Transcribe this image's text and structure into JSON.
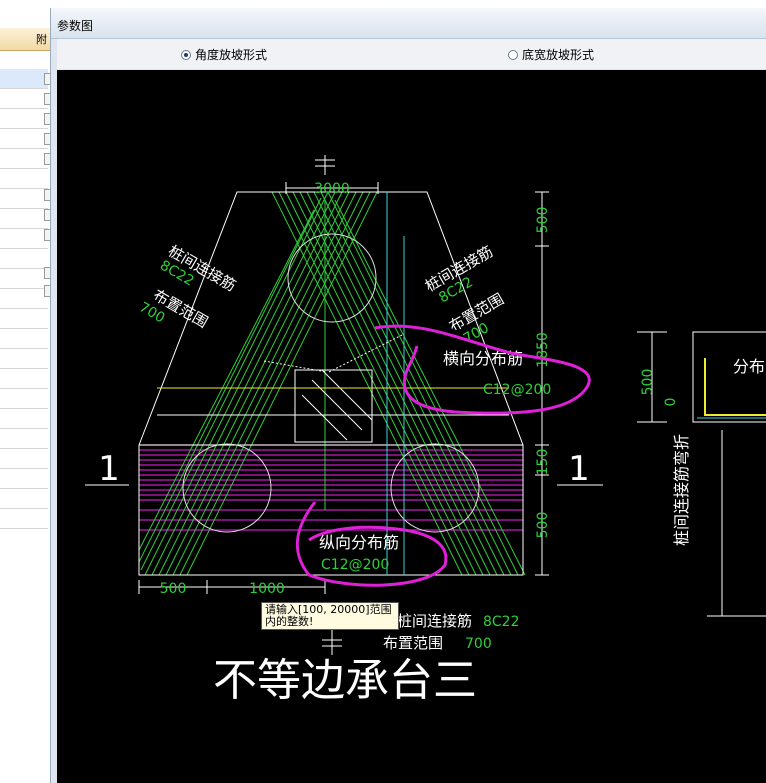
{
  "background_panel": {
    "column_header": "附"
  },
  "dialog": {
    "title": "参数图",
    "options": [
      {
        "label": "角度放坡形式",
        "selected": true
      },
      {
        "label": "底宽放坡形式",
        "selected": false
      }
    ]
  },
  "drawing": {
    "title": "不等边承台三",
    "dims": {
      "top_width": "3000",
      "right_top": "500",
      "right_mid": "1850",
      "right_low": "150",
      "right_bottom": "500",
      "bottom_left": "500",
      "bottom_mid": "1000",
      "side_500": "500",
      "side_0": "0"
    },
    "section_mark": "1",
    "labels": {
      "left_pile_link": "桩间连接筋",
      "left_pile_link_val": "8C22",
      "left_layout": "布置范围",
      "left_layout_val": "700",
      "right_pile_link": "桩间连接筋",
      "right_pile_link_val": "8C22",
      "right_layout": "布置范围",
      "right_layout_val": "700",
      "horiz_dist": "横向分布筋",
      "horiz_dist_val": "C12@200",
      "long_dist": "纵向分布筋",
      "long_dist_val": "C12@200",
      "bottom_pile_link": "桩间连接筋",
      "bottom_pile_link_val": "8C22",
      "bottom_layout": "布置范围",
      "bottom_layout_val": "700",
      "side_dist": "分布",
      "side_vertical": "桩间连接筋弯折"
    },
    "tooltip": "请输入[100, 20000]范围内的整数!"
  },
  "colors": {
    "canvas_bg": "#000000",
    "outline": "#ffffff",
    "green_rebar": "#2fcf3a",
    "magenta_rebar": "#c21dc2",
    "cyan": "#3fd0d8",
    "yellow": "#ecec2e",
    "annotation": "#e020d8"
  }
}
